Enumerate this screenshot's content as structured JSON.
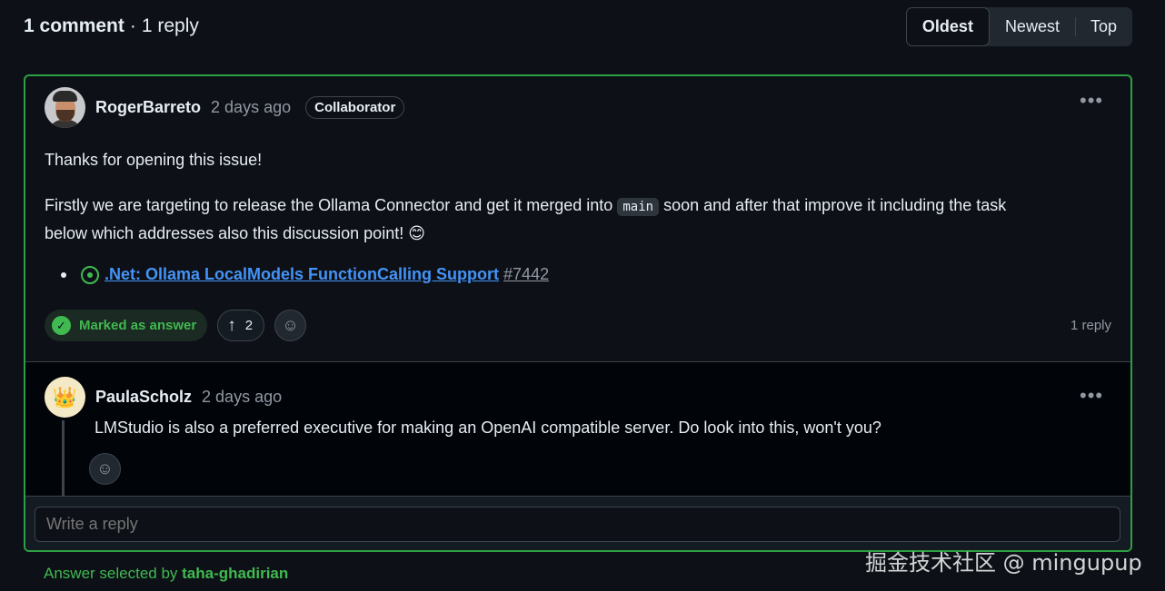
{
  "header": {
    "comment_count": "1 comment",
    "separator": "·",
    "reply_count": "1 reply",
    "sort_options": [
      "Oldest",
      "Newest",
      "Top"
    ],
    "active_sort": "Oldest"
  },
  "comment": {
    "author": "RogerBarreto",
    "time": "2 days ago",
    "badge": "Collaborator",
    "paragraph1": "Thanks for opening this issue!",
    "paragraph2_before": "Firstly we are targeting to release the Ollama Connector and get it merged into",
    "paragraph2_code": "main",
    "paragraph2_after": "soon and after that improve it including the task",
    "paragraph2_line2": "below which addresses also this discussion point! 😊",
    "linked_issue": {
      "title": ".Net: Ollama LocalModels FunctionCalling Support",
      "number": "#7442"
    },
    "answer_label": "Marked as answer",
    "upvotes": "2",
    "replies_label": "1 reply"
  },
  "reply": {
    "author": "PaulaScholz",
    "time": "2 days ago",
    "text": "LMStudio is also a preferred executive for making an OpenAI compatible server. Do look into this, won't you?",
    "avatar_glyph": "👑"
  },
  "reply_box": {
    "placeholder": "Write a reply"
  },
  "footer": {
    "prefix": "Answer selected by",
    "user": "taha-ghadirian"
  },
  "watermark": "掘金技术社区 @ mingupup",
  "colors": {
    "accent_green": "#3fb950",
    "link_blue": "#4493f8",
    "background": "#0d1117"
  }
}
